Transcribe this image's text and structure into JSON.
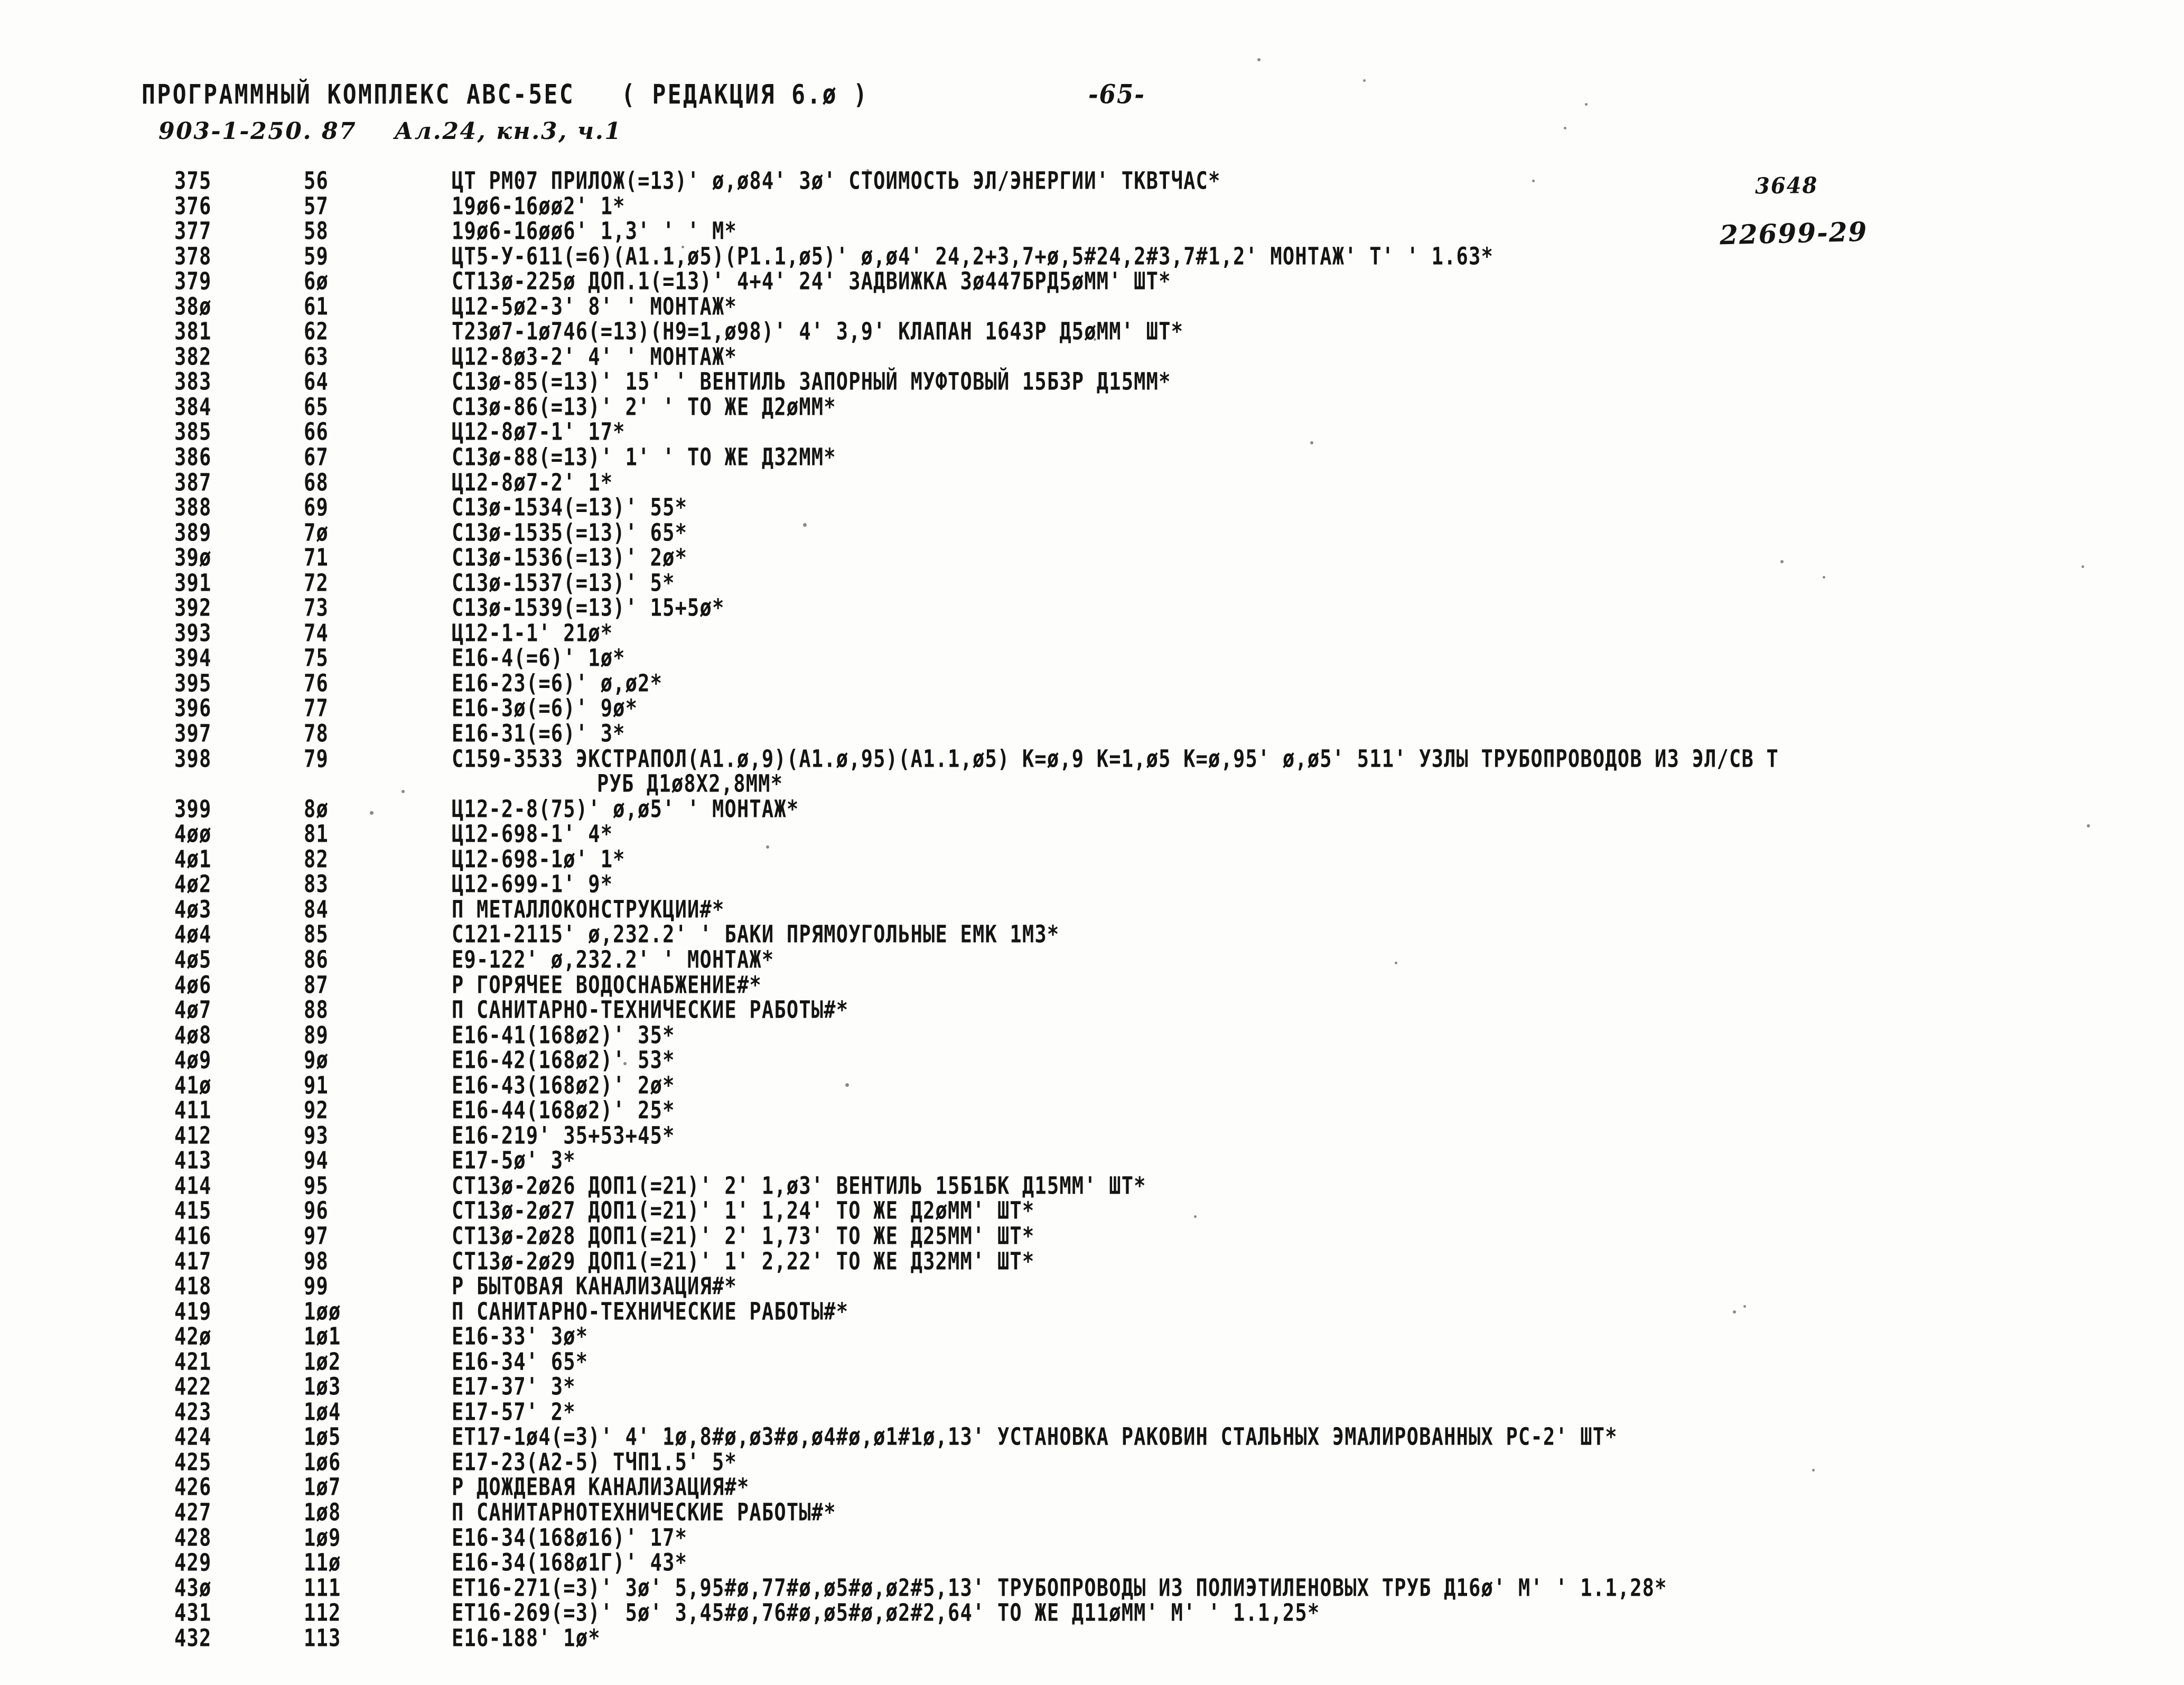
{
  "document": {
    "kind": "line-printer-listing-scan",
    "page_background": "#fdfdfb",
    "ink_color": "#141414"
  },
  "header": {
    "program_title": "ПРОГРАММНЫЙ КОМПЛЕКС АВС-5ЕС   ( РЕДАКЦИЯ 6.ø )",
    "page_number": "-65-",
    "project_code": "903-1-250. 87    Ал.24, кн.3, ч.1",
    "sheet_number": "3648",
    "archive_stamp": "22699-29"
  },
  "listing": {
    "columns": [
      "seq",
      "num",
      "text"
    ],
    "rows": [
      {
        "seq": "375",
        "num": "56",
        "text": "ЦТ РМ07 ПРИЛОЖ(=13)' ø,ø84' 3ø' СТОИМОСТЬ ЭЛ/ЭНЕРГИИ' ТКВТЧАС*"
      },
      {
        "seq": "376",
        "num": "57",
        "text": "19ø6-16øø2' 1*"
      },
      {
        "seq": "377",
        "num": "58",
        "text": "19ø6-16øø6' 1,3' ' ' М*"
      },
      {
        "seq": "378",
        "num": "59",
        "text": "ЦТ5-У-611(=6)(А1.1,ø5)(Р1.1,ø5)' ø,ø4' 24,2+3,7+ø,5#24,2#3,7#1,2' МОНТАЖ' Т' ' 1.63*"
      },
      {
        "seq": "379",
        "num": "6ø",
        "text": "СТ13ø-225ø ДОП.1(=13)' 4+4' 24' ЗАДВИЖКА 3ø447БРД5øММ' ШТ*"
      },
      {
        "seq": "38ø",
        "num": "61",
        "text": "Ц12-5ø2-3' 8' ' МОНТАЖ*"
      },
      {
        "seq": "381",
        "num": "62",
        "text": "Т23ø7-1ø746(=13)(Н9=1,ø98)' 4' 3,9' КЛАПАН 1643Р Д5øММ' ШТ*"
      },
      {
        "seq": "382",
        "num": "63",
        "text": "Ц12-8ø3-2' 4' ' МОНТАЖ*"
      },
      {
        "seq": "383",
        "num": "64",
        "text": "С13ø-85(=13)' 15' ' ВЕНТИЛЬ ЗАПОРНЫЙ МУФТОВЫЙ 15Б3Р Д15ММ*"
      },
      {
        "seq": "384",
        "num": "65",
        "text": "С13ø-86(=13)' 2' ' ТО ЖЕ Д2øММ*"
      },
      {
        "seq": "385",
        "num": "66",
        "text": "Ц12-8ø7-1' 17*"
      },
      {
        "seq": "386",
        "num": "67",
        "text": "С13ø-88(=13)' 1' ' ТО ЖЕ Д32ММ*"
      },
      {
        "seq": "387",
        "num": "68",
        "text": "Ц12-8ø7-2' 1*"
      },
      {
        "seq": "388",
        "num": "69",
        "text": "С13ø-1534(=13)' 55*"
      },
      {
        "seq": "389",
        "num": "7ø",
        "text": "С13ø-1535(=13)' 65*"
      },
      {
        "seq": "39ø",
        "num": "71",
        "text": "С13ø-1536(=13)' 2ø*"
      },
      {
        "seq": "391",
        "num": "72",
        "text": "С13ø-1537(=13)' 5*"
      },
      {
        "seq": "392",
        "num": "73",
        "text": "С13ø-1539(=13)' 15+5ø*"
      },
      {
        "seq": "393",
        "num": "74",
        "text": "Ц12-1-1' 21ø*"
      },
      {
        "seq": "394",
        "num": "75",
        "text": "Е16-4(=6)' 1ø*"
      },
      {
        "seq": "395",
        "num": "76",
        "text": "Е16-23(=6)' ø,ø2*"
      },
      {
        "seq": "396",
        "num": "77",
        "text": "Е16-3ø(=6)' 9ø*"
      },
      {
        "seq": "397",
        "num": "78",
        "text": "Е16-31(=6)' 3*"
      },
      {
        "seq": "398",
        "num": "79",
        "text": "С159-3533 ЭКСТРАПОЛ(А1.ø,9)(А1.ø,95)(А1.1,ø5) К=ø,9 К=1,ø5 К=ø,95' ø,ø5' 511' УЗЛЫ ТРУБОПРОВОДОВ ИЗ ЭЛ/СВ Т",
        "cont": "РУБ Д1ø8Х2,8ММ*"
      },
      {
        "seq": "399",
        "num": "8ø",
        "text": "Ц12-2-8(75)' ø,ø5' ' МОНТАЖ*"
      },
      {
        "seq": "4øø",
        "num": "81",
        "text": "Ц12-698-1' 4*"
      },
      {
        "seq": "4ø1",
        "num": "82",
        "text": "Ц12-698-1ø' 1*"
      },
      {
        "seq": "4ø2",
        "num": "83",
        "text": "Ц12-699-1' 9*"
      },
      {
        "seq": "4ø3",
        "num": "84",
        "text": "П МЕТАЛЛОКОНСТРУКЦИИ#*"
      },
      {
        "seq": "4ø4",
        "num": "85",
        "text": "С121-2115' ø,232.2' ' БАКИ ПРЯМОУГОЛЬНЫЕ ЕМК 1М3*"
      },
      {
        "seq": "4ø5",
        "num": "86",
        "text": "Е9-122' ø,232.2' ' МОНТАЖ*"
      },
      {
        "seq": "4ø6",
        "num": "87",
        "text": "Р ГОРЯЧЕЕ ВОДОСНАБЖЕНИЕ#*"
      },
      {
        "seq": "4ø7",
        "num": "88",
        "text": "П САНИТАРНО-ТЕХНИЧЕСКИЕ РАБОТЫ#*"
      },
      {
        "seq": "4ø8",
        "num": "89",
        "text": "Е16-41(168ø2)' 35*"
      },
      {
        "seq": "4ø9",
        "num": "9ø",
        "text": "Е16-42(168ø2)' 53*"
      },
      {
        "seq": "41ø",
        "num": "91",
        "text": "Е16-43(168ø2)' 2ø*"
      },
      {
        "seq": "411",
        "num": "92",
        "text": "Е16-44(168ø2)' 25*"
      },
      {
        "seq": "412",
        "num": "93",
        "text": "Е16-219' 35+53+45*"
      },
      {
        "seq": "413",
        "num": "94",
        "text": "Е17-5ø' 3*"
      },
      {
        "seq": "414",
        "num": "95",
        "text": "СТ13ø-2ø26 ДОП1(=21)' 2' 1,ø3' ВЕНТИЛЬ 15Б1БК Д15ММ' ШТ*"
      },
      {
        "seq": "415",
        "num": "96",
        "text": "СТ13ø-2ø27 ДОП1(=21)' 1' 1,24' ТО ЖЕ Д2øММ' ШТ*"
      },
      {
        "seq": "416",
        "num": "97",
        "text": "СТ13ø-2ø28 ДОП1(=21)' 2' 1,73' ТО ЖЕ Д25ММ' ШТ*"
      },
      {
        "seq": "417",
        "num": "98",
        "text": "СТ13ø-2ø29 ДОП1(=21)' 1' 2,22' ТО ЖЕ Д32ММ' ШТ*"
      },
      {
        "seq": "418",
        "num": "99",
        "text": "Р БЫТОВАЯ КАНАЛИЗАЦИЯ#*"
      },
      {
        "seq": "419",
        "num": "1øø",
        "text": "П САНИТАРНО-ТЕХНИЧЕСКИЕ РАБОТЫ#*"
      },
      {
        "seq": "42ø",
        "num": "1ø1",
        "text": "Е16-33' 3ø*"
      },
      {
        "seq": "421",
        "num": "1ø2",
        "text": "Е16-34' 65*"
      },
      {
        "seq": "422",
        "num": "1ø3",
        "text": "Е17-37' 3*"
      },
      {
        "seq": "423",
        "num": "1ø4",
        "text": "Е17-57' 2*"
      },
      {
        "seq": "424",
        "num": "1ø5",
        "text": "ЕТ17-1ø4(=3)' 4' 1ø,8#ø,ø3#ø,ø4#ø,ø1#1ø,13' УСТАНОВКА РАКОВИН СТАЛЬНЫХ ЭМАЛИРОВАННЫХ РС-2' ШТ*"
      },
      {
        "seq": "425",
        "num": "1ø6",
        "text": "Е17-23(А2-5) ТЧП1.5' 5*"
      },
      {
        "seq": "426",
        "num": "1ø7",
        "text": "Р ДОЖДЕВАЯ КАНАЛИЗАЦИЯ#*"
      },
      {
        "seq": "427",
        "num": "1ø8",
        "text": "П САНИТАРНОТЕХНИЧЕСКИЕ РАБОТЫ#*"
      },
      {
        "seq": "428",
        "num": "1ø9",
        "text": "Е16-34(168ø16)' 17*"
      },
      {
        "seq": "429",
        "num": "11ø",
        "text": "Е16-34(168ø1Г)' 43*"
      },
      {
        "seq": "43ø",
        "num": "111",
        "text": "ЕТ16-271(=3)' 3ø' 5,95#ø,77#ø,ø5#ø,ø2#5,13' ТРУБОПРОВОДЫ ИЗ ПОЛИЭТИЛЕНОВЫХ ТРУБ Д16ø' М' ' 1.1,28*"
      },
      {
        "seq": "431",
        "num": "112",
        "text": "ЕТ16-269(=3)' 5ø' 3,45#ø,76#ø,ø5#ø,ø2#2,64' ТО ЖЕ Д11øММ' М' ' 1.1,25*"
      },
      {
        "seq": "432",
        "num": "113",
        "text": "Е16-188' 1ø*"
      }
    ]
  }
}
